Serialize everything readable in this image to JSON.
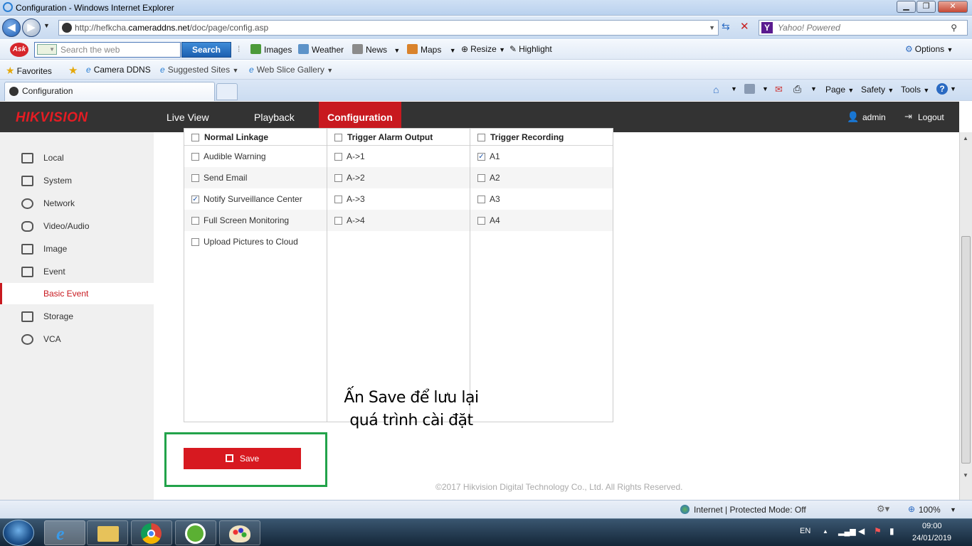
{
  "window": {
    "title": "Configuration - Windows Internet Explorer",
    "minimize": "▁",
    "maximize": "❐",
    "close": "✕"
  },
  "addressbar": {
    "url_prefix": "http://hefkcha.",
    "url_domain": "cameraddns.net",
    "url_path": "/doc/page/config.asp",
    "search_placeholder": "Yahoo! Powered"
  },
  "asktoolbar": {
    "search_placeholder": "Search the web",
    "search_button": "Search",
    "items": [
      "Images",
      "Weather",
      "News",
      "Maps",
      "Resize",
      "Highlight"
    ],
    "options": "Options"
  },
  "favorites": {
    "label": "Favorites",
    "items": [
      "Camera DDNS",
      "Suggested Sites",
      "Web Slice Gallery"
    ]
  },
  "tabs": {
    "active": "Configuration"
  },
  "commandbar": {
    "items": [
      "Page",
      "Safety",
      "Tools"
    ]
  },
  "app": {
    "logo": "HIKVISION",
    "nav": [
      "Live View",
      "Playback",
      "Configuration"
    ],
    "user": "admin",
    "logout": "Logout"
  },
  "sidebar": {
    "items": [
      "Local",
      "System",
      "Network",
      "Video/Audio",
      "Image",
      "Event",
      "Basic Event",
      "Storage",
      "VCA"
    ]
  },
  "linkage": {
    "columns": [
      {
        "header": "Normal Linkage",
        "header_checked": false,
        "rows": [
          {
            "label": "Audible Warning",
            "checked": false
          },
          {
            "label": "Send Email",
            "checked": false
          },
          {
            "label": "Notify Surveillance Center",
            "checked": true
          },
          {
            "label": "Full Screen Monitoring",
            "checked": false
          },
          {
            "label": "Upload Pictures to Cloud",
            "checked": false
          }
        ]
      },
      {
        "header": "Trigger Alarm Output",
        "header_checked": false,
        "rows": [
          {
            "label": "A->1",
            "checked": false
          },
          {
            "label": "A->2",
            "checked": false
          },
          {
            "label": "A->3",
            "checked": false
          },
          {
            "label": "A->4",
            "checked": false
          }
        ]
      },
      {
        "header": "Trigger Recording",
        "header_checked": false,
        "rows": [
          {
            "label": "A1",
            "checked": true
          },
          {
            "label": "A2",
            "checked": false
          },
          {
            "label": "A3",
            "checked": false
          },
          {
            "label": "A4",
            "checked": false
          }
        ]
      }
    ]
  },
  "annotation": {
    "line1": "Ấn Save để lưu lại",
    "line2": "quá trình cài đặt"
  },
  "save_button": "Save",
  "copyright": "©2017 Hikvision Digital Technology Co., Ltd. All Rights Reserved.",
  "statusbar": {
    "zone": "Internet | Protected Mode: Off",
    "zoom": "100%"
  },
  "taskbar": {
    "lang": "EN",
    "time": "09:00",
    "date": "24/01/2019"
  },
  "colors": {
    "accent": "#c8191f",
    "header_bg": "#333333",
    "highlight_box": "#22a34a"
  }
}
